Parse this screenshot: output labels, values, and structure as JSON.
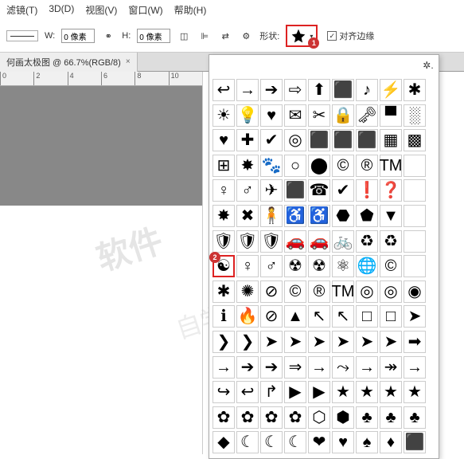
{
  "menu": [
    "滤镜(T)",
    "3D(D)",
    "视图(V)",
    "窗口(W)",
    "帮助(H)"
  ],
  "options": {
    "w_label": "W:",
    "w_value": "0 像素",
    "h_label": "H:",
    "h_value": "0 像素",
    "shape_label": "形状:",
    "align_label": "对齐边缘"
  },
  "doc_tab": "何画太极图 @ 66.7%(RGB/8)",
  "ruler_ticks": [
    "0",
    "2",
    "4",
    "6",
    "8",
    "10"
  ],
  "badge1": "1",
  "badge2": "2",
  "shapes": [
    "↩",
    "→",
    "➔",
    "⇨",
    "⬆",
    "⬛",
    "♪",
    "⚡",
    "✱",
    "☀",
    "💡",
    "♥",
    "✉",
    "✂",
    "🔒",
    "🗝",
    "▀",
    "░",
    "♥",
    "✚",
    "✔",
    "◎",
    "⬛",
    "⬛",
    "⬛",
    "▦",
    "▩",
    "⊞",
    "✸",
    "🐾",
    "○",
    "⬤",
    "©",
    "®",
    "TM",
    " ",
    "♀",
    "♂",
    "✈",
    "⬛",
    "☎",
    "✔",
    "❗",
    "❓",
    " ",
    "✸",
    "✖",
    "🧍",
    "♿",
    "♿",
    "⬣",
    "⬟",
    "▼",
    " ",
    "🛡",
    "🛡",
    "🛡",
    "🚗",
    "🚗",
    "🚲",
    "♻",
    "♻",
    " ",
    "☯",
    "♀",
    "♂",
    "☢",
    "☢",
    "⚛",
    "🌐",
    "©",
    " ",
    "✱",
    "✺",
    "⊘",
    "©",
    "®",
    "TM",
    "◎",
    "◎",
    "◉",
    "ℹ",
    "🔥",
    "⊘",
    "▲",
    "↖",
    "↖",
    "□",
    "□",
    "➤",
    "❯",
    "❯",
    "➤",
    "➤",
    "➤",
    "➤",
    "➤",
    "➤",
    "➡",
    "→",
    "➔",
    "➔",
    "⇒",
    "→",
    "⤳",
    "→",
    "↠",
    "→",
    "↪",
    "↩",
    "↱",
    "▶",
    "▶",
    "★",
    "★",
    "★",
    "★",
    "✿",
    "✿",
    "✿",
    "✿",
    "⬡",
    "⬢",
    "♣",
    "♣",
    "♣",
    "◆",
    "☾",
    "☾",
    "☾",
    "❤",
    "♥",
    "♠",
    "♦",
    "⬛"
  ],
  "selected_shape_index": 63,
  "watermark": "软件",
  "watermark2": "自学"
}
